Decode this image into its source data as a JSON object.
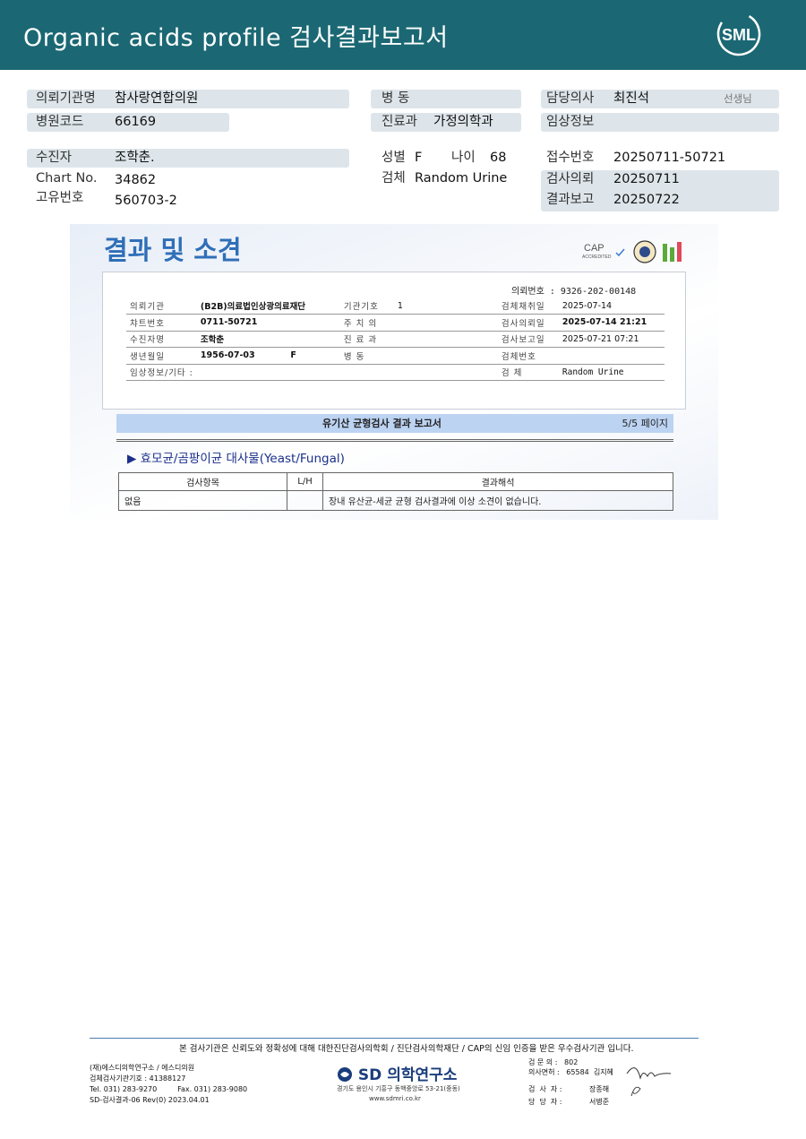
{
  "header": {
    "title": "Organic acids profile 검사결과보고서",
    "logo_text": "SML"
  },
  "patient_info": {
    "institution_label": "의뢰기관명",
    "institution_value": "참사랑연합의원",
    "hospital_code_label": "병원코드",
    "hospital_code_value": "66169",
    "ward_label": "병   동",
    "ward_value": "",
    "department_label": "진료과",
    "department_value": "가정의학과",
    "doctor_label": "담당의사",
    "doctor_value": "최진석",
    "doctor_suffix": "선생님",
    "clinical_label": "임상정보",
    "clinical_value": "",
    "patient_label": "수진자",
    "patient_value": "조학춘.",
    "chart_label": "Chart No.",
    "chart_value": "34862",
    "unique_label": "고유번호",
    "unique_value": "560703-2",
    "sex_label": "성별",
    "sex_value": "F",
    "age_label": "나이",
    "age_value": "68",
    "specimen_label": "검체",
    "specimen_value": "Random Urine",
    "receipt_label": "접수번호",
    "receipt_value": "20250711-50721",
    "request_label": "검사의뢰",
    "request_value": "20250711",
    "report_label": "결과보고",
    "report_value": "20250722"
  },
  "report": {
    "title": "결과 및 소견",
    "accreditation": "CAP ACCREDITED",
    "request_no": "의뢰번호 : 9326-202-00148",
    "rows": [
      [
        "의뢰기관",
        "(B2B)의료법인상광의료재단",
        "기관기호",
        "1",
        "검체채취일",
        "2025-07-14"
      ],
      [
        "챠트번호",
        "0711-50721",
        "주 치 의",
        "",
        "검사의뢰일",
        "2025-07-14 21:21"
      ],
      [
        "수진자명",
        "조학춘",
        "진 료 과",
        "",
        "검사보고일",
        "2025-07-21 07:21"
      ],
      [
        "생년월일",
        "1956-07-03            F",
        "병    동",
        "",
        "검체번호",
        ""
      ],
      [
        "임상정보/기타 :",
        "",
        "",
        "",
        "검    체",
        "Random Urine"
      ]
    ],
    "bar_title": "유기산 균형검사 결과 보고서",
    "page": "5/5 페이지",
    "section": "▶ 효모균/곰팡이균 대사물(Yeast/Fungal)",
    "columns": [
      "검사항목",
      "L/H",
      "결과해석"
    ],
    "result_row": [
      "없음",
      "",
      "장내 유산균-세균 균형 검사결과에 이상 소견이 없습니다."
    ]
  },
  "footer": {
    "note": "본 검사기관은 신뢰도와 정확성에 대해 대한진단검사의학회 / 진단검사의학재단 / CAP의 신임 인증을 받은 우수검사기관 입니다.",
    "left1": "(재)에스디의학연구소 / 에스디의원",
    "left2": "검체검사기관기호 : 41388127",
    "left3": "Tel. 031) 283-9270         Fax. 031) 283-9080",
    "left4": "SD-검사결과-06 Rev(0) 2023.04.01",
    "brand": "SD 의학연구소",
    "addr1": "경기도 용인시 기흥구 동백중앙로 53-21(중동)",
    "addr2": "www.sdmri.co.kr",
    "r1": "검 문 의 :   802",
    "r2": "의사면허 :   65584  김지혜",
    "r3": "검  사  자 :            장종해",
    "r4": "당  당  자 :            서병준"
  }
}
